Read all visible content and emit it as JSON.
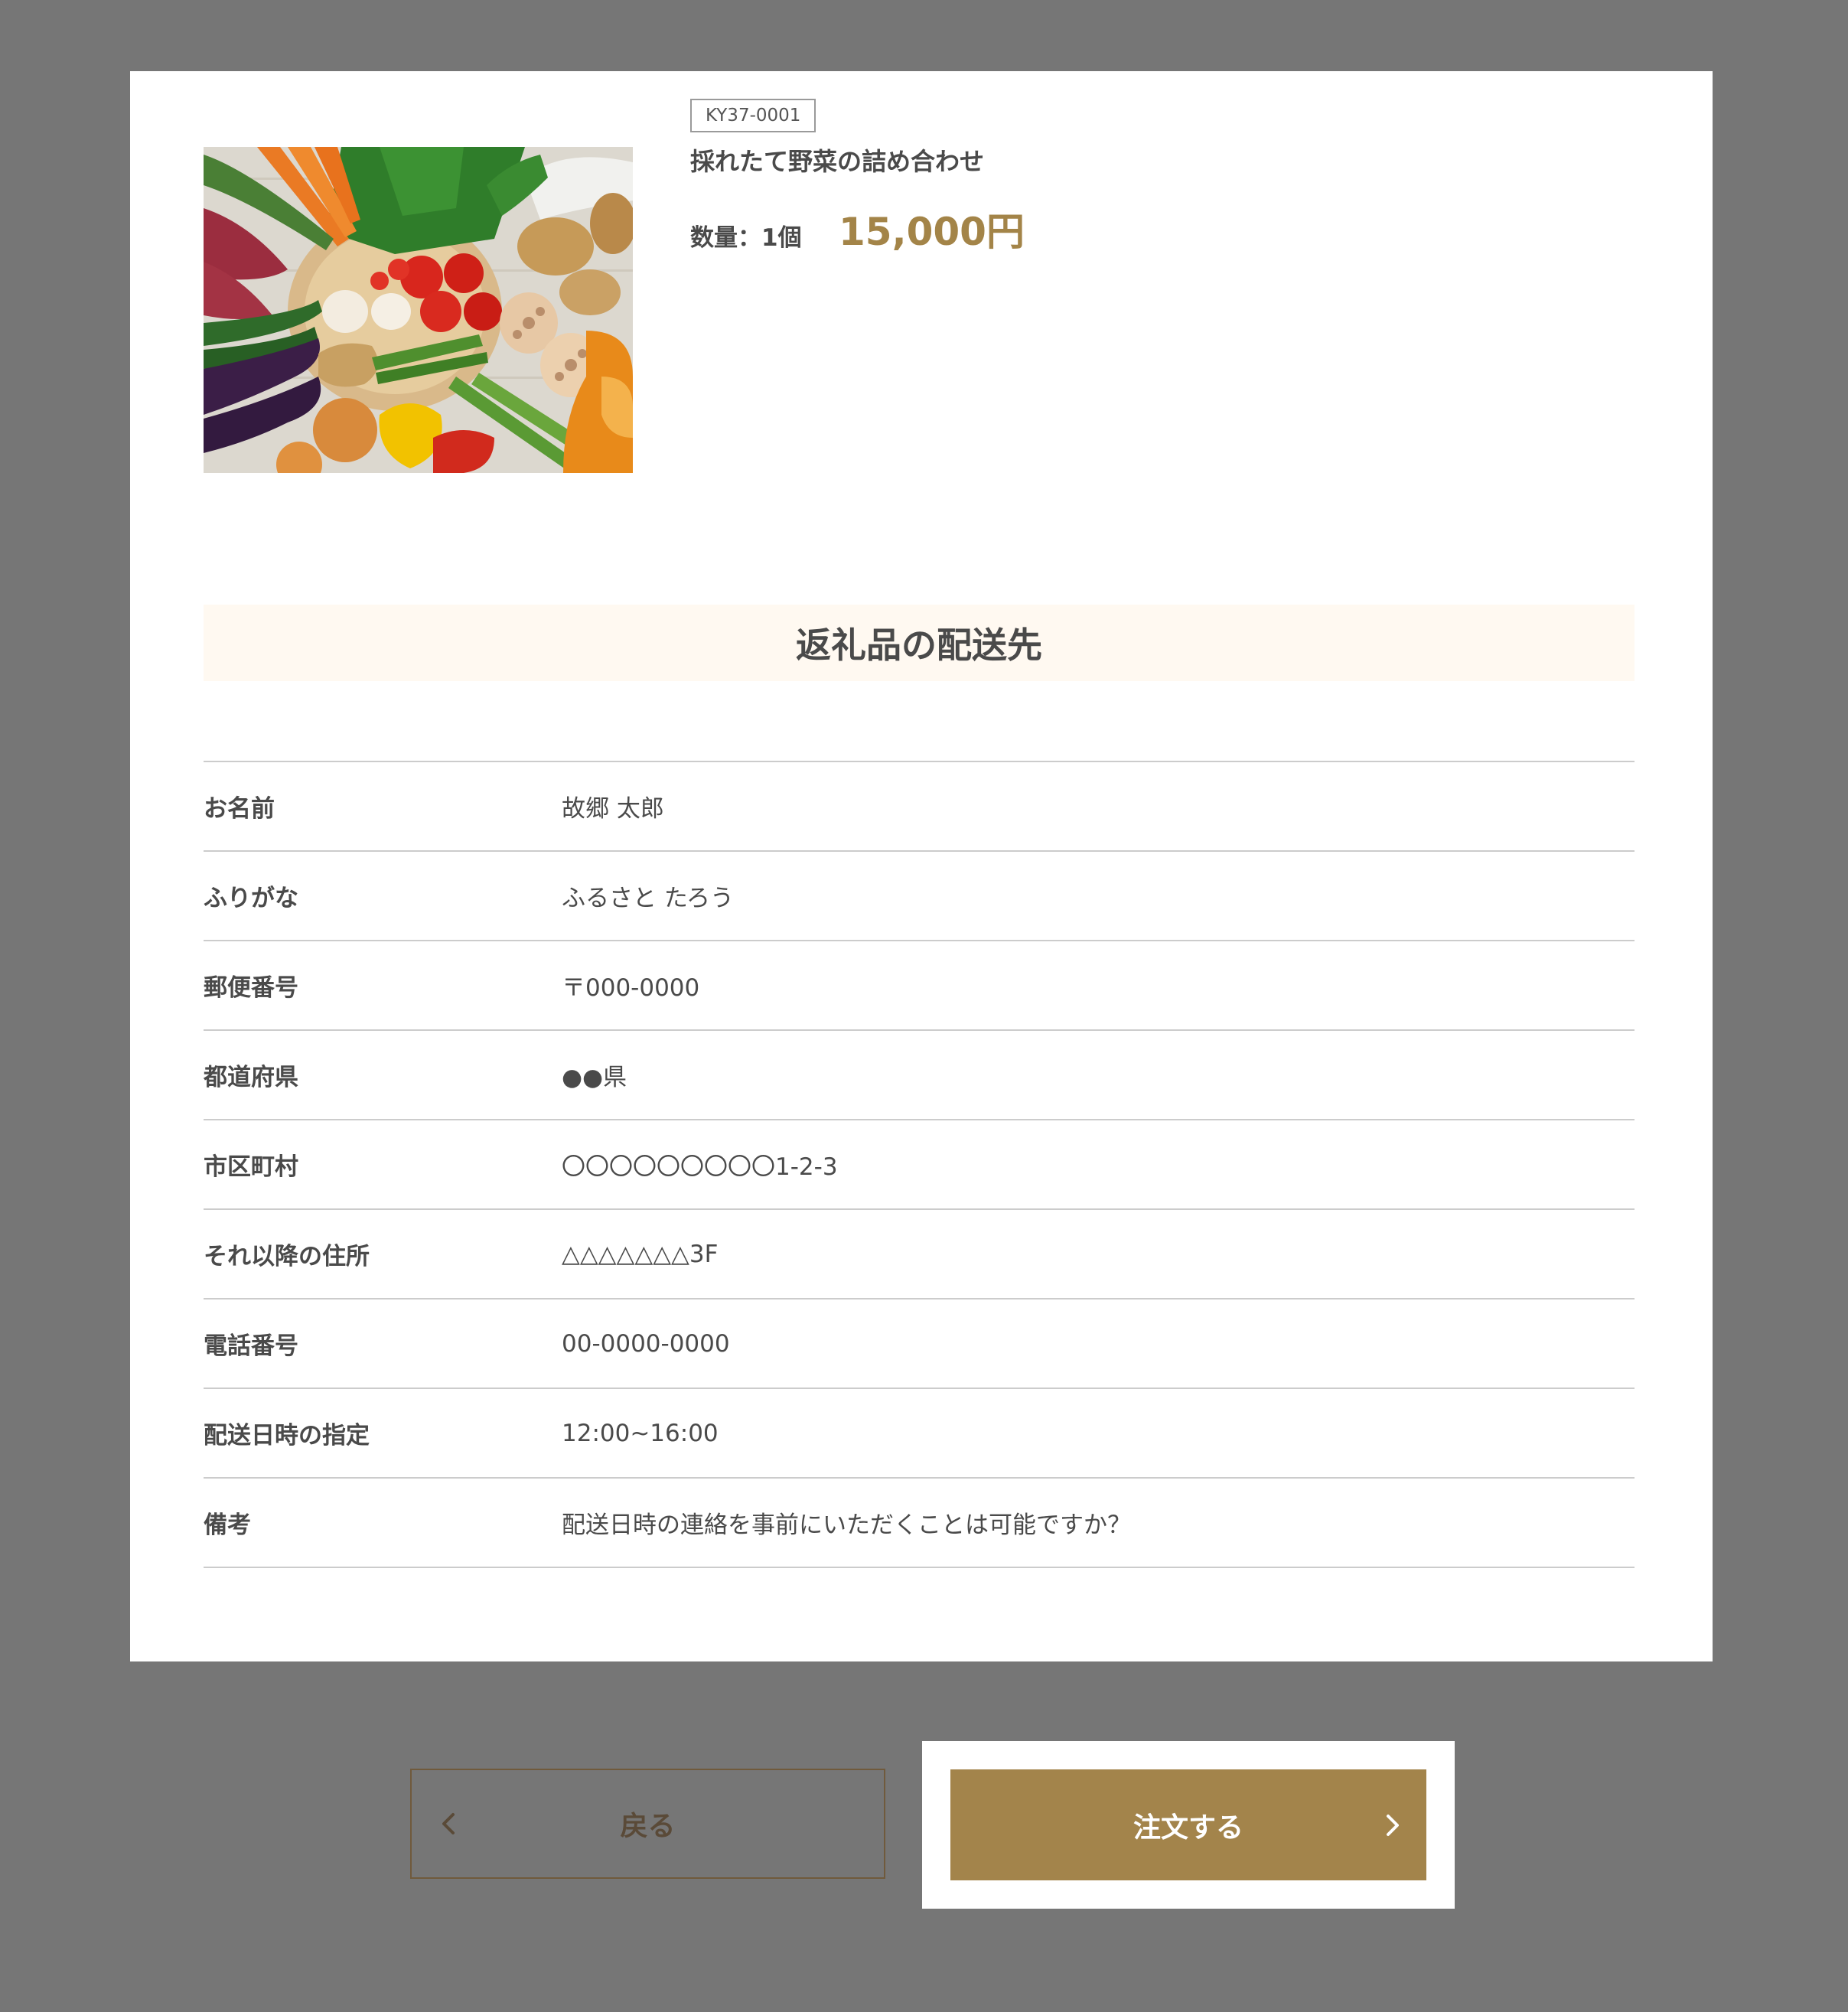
{
  "product": {
    "code": "KY37-0001",
    "name": "採れたて野菜の詰め合わせ",
    "quantity_label": "数量：1個",
    "price": "15,000円",
    "image_icon": "vegetables-photo"
  },
  "shipping": {
    "title": "返礼品の配送先",
    "rows": [
      {
        "label": "お名前",
        "value": "故郷 太郎"
      },
      {
        "label": "ふりがな",
        "value": "ふるさと たろう"
      },
      {
        "label": "郵便番号",
        "value": "〒000-0000"
      },
      {
        "label": "都道府県",
        "value": "●●県"
      },
      {
        "label": "市区町村",
        "value": "〇〇〇〇〇〇〇〇〇1-2-3"
      },
      {
        "label": "それ以降の住所",
        "value": "△△△△△△△3F"
      },
      {
        "label": "電話番号",
        "value": "00-0000-0000"
      },
      {
        "label": "配送日時の指定",
        "value": "12:00~16:00"
      },
      {
        "label": "備考",
        "value": "配送日時の連絡を事前にいただくことは可能ですか？"
      }
    ]
  },
  "actions": {
    "back_label": "戻る",
    "order_label": "注文する",
    "back_icon": "chevron-left-icon",
    "order_icon": "chevron-right-icon"
  },
  "colors": {
    "background": "#767676",
    "panel": "#ffffff",
    "accent": "#a3844b",
    "section_header_bg": "#fff9f1"
  }
}
